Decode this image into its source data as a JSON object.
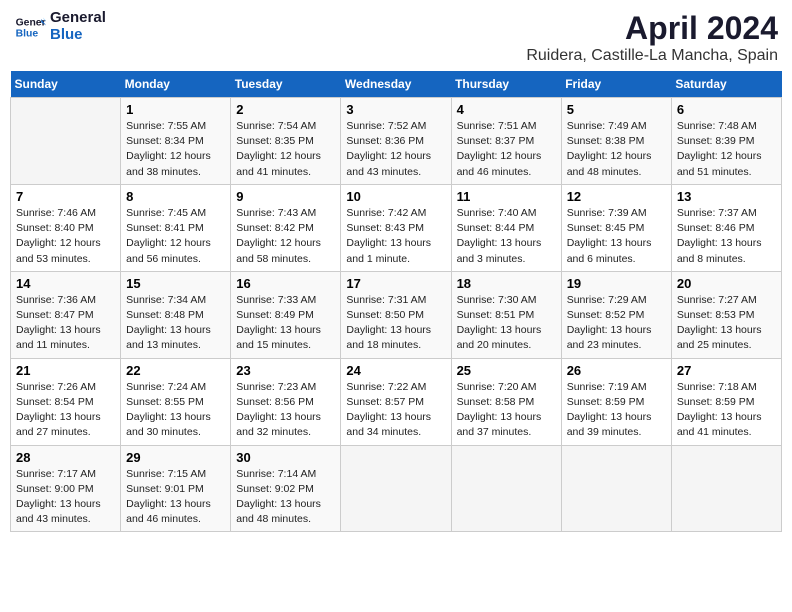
{
  "logo": {
    "line1": "General",
    "line2": "Blue"
  },
  "title": "April 2024",
  "subtitle": "Ruidera, Castille-La Mancha, Spain",
  "days_of_week": [
    "Sunday",
    "Monday",
    "Tuesday",
    "Wednesday",
    "Thursday",
    "Friday",
    "Saturday"
  ],
  "weeks": [
    [
      {
        "day": "",
        "info": ""
      },
      {
        "day": "1",
        "info": "Sunrise: 7:55 AM\nSunset: 8:34 PM\nDaylight: 12 hours\nand 38 minutes."
      },
      {
        "day": "2",
        "info": "Sunrise: 7:54 AM\nSunset: 8:35 PM\nDaylight: 12 hours\nand 41 minutes."
      },
      {
        "day": "3",
        "info": "Sunrise: 7:52 AM\nSunset: 8:36 PM\nDaylight: 12 hours\nand 43 minutes."
      },
      {
        "day": "4",
        "info": "Sunrise: 7:51 AM\nSunset: 8:37 PM\nDaylight: 12 hours\nand 46 minutes."
      },
      {
        "day": "5",
        "info": "Sunrise: 7:49 AM\nSunset: 8:38 PM\nDaylight: 12 hours\nand 48 minutes."
      },
      {
        "day": "6",
        "info": "Sunrise: 7:48 AM\nSunset: 8:39 PM\nDaylight: 12 hours\nand 51 minutes."
      }
    ],
    [
      {
        "day": "7",
        "info": "Sunrise: 7:46 AM\nSunset: 8:40 PM\nDaylight: 12 hours\nand 53 minutes."
      },
      {
        "day": "8",
        "info": "Sunrise: 7:45 AM\nSunset: 8:41 PM\nDaylight: 12 hours\nand 56 minutes."
      },
      {
        "day": "9",
        "info": "Sunrise: 7:43 AM\nSunset: 8:42 PM\nDaylight: 12 hours\nand 58 minutes."
      },
      {
        "day": "10",
        "info": "Sunrise: 7:42 AM\nSunset: 8:43 PM\nDaylight: 13 hours\nand 1 minute."
      },
      {
        "day": "11",
        "info": "Sunrise: 7:40 AM\nSunset: 8:44 PM\nDaylight: 13 hours\nand 3 minutes."
      },
      {
        "day": "12",
        "info": "Sunrise: 7:39 AM\nSunset: 8:45 PM\nDaylight: 13 hours\nand 6 minutes."
      },
      {
        "day": "13",
        "info": "Sunrise: 7:37 AM\nSunset: 8:46 PM\nDaylight: 13 hours\nand 8 minutes."
      }
    ],
    [
      {
        "day": "14",
        "info": "Sunrise: 7:36 AM\nSunset: 8:47 PM\nDaylight: 13 hours\nand 11 minutes."
      },
      {
        "day": "15",
        "info": "Sunrise: 7:34 AM\nSunset: 8:48 PM\nDaylight: 13 hours\nand 13 minutes."
      },
      {
        "day": "16",
        "info": "Sunrise: 7:33 AM\nSunset: 8:49 PM\nDaylight: 13 hours\nand 15 minutes."
      },
      {
        "day": "17",
        "info": "Sunrise: 7:31 AM\nSunset: 8:50 PM\nDaylight: 13 hours\nand 18 minutes."
      },
      {
        "day": "18",
        "info": "Sunrise: 7:30 AM\nSunset: 8:51 PM\nDaylight: 13 hours\nand 20 minutes."
      },
      {
        "day": "19",
        "info": "Sunrise: 7:29 AM\nSunset: 8:52 PM\nDaylight: 13 hours\nand 23 minutes."
      },
      {
        "day": "20",
        "info": "Sunrise: 7:27 AM\nSunset: 8:53 PM\nDaylight: 13 hours\nand 25 minutes."
      }
    ],
    [
      {
        "day": "21",
        "info": "Sunrise: 7:26 AM\nSunset: 8:54 PM\nDaylight: 13 hours\nand 27 minutes."
      },
      {
        "day": "22",
        "info": "Sunrise: 7:24 AM\nSunset: 8:55 PM\nDaylight: 13 hours\nand 30 minutes."
      },
      {
        "day": "23",
        "info": "Sunrise: 7:23 AM\nSunset: 8:56 PM\nDaylight: 13 hours\nand 32 minutes."
      },
      {
        "day": "24",
        "info": "Sunrise: 7:22 AM\nSunset: 8:57 PM\nDaylight: 13 hours\nand 34 minutes."
      },
      {
        "day": "25",
        "info": "Sunrise: 7:20 AM\nSunset: 8:58 PM\nDaylight: 13 hours\nand 37 minutes."
      },
      {
        "day": "26",
        "info": "Sunrise: 7:19 AM\nSunset: 8:59 PM\nDaylight: 13 hours\nand 39 minutes."
      },
      {
        "day": "27",
        "info": "Sunrise: 7:18 AM\nSunset: 8:59 PM\nDaylight: 13 hours\nand 41 minutes."
      }
    ],
    [
      {
        "day": "28",
        "info": "Sunrise: 7:17 AM\nSunset: 9:00 PM\nDaylight: 13 hours\nand 43 minutes."
      },
      {
        "day": "29",
        "info": "Sunrise: 7:15 AM\nSunset: 9:01 PM\nDaylight: 13 hours\nand 46 minutes."
      },
      {
        "day": "30",
        "info": "Sunrise: 7:14 AM\nSunset: 9:02 PM\nDaylight: 13 hours\nand 48 minutes."
      },
      {
        "day": "",
        "info": ""
      },
      {
        "day": "",
        "info": ""
      },
      {
        "day": "",
        "info": ""
      },
      {
        "day": "",
        "info": ""
      }
    ]
  ]
}
